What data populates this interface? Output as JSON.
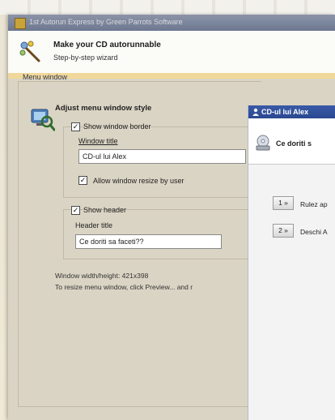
{
  "window": {
    "title": "1st Autorun Express by Green Parrots Software"
  },
  "header": {
    "title": "Make your CD autorunnable",
    "subtitle": "Step-by-step wizard"
  },
  "group": {
    "label": "Menu window",
    "section_title": "Adjust menu window style"
  },
  "border_options": {
    "show_border_label": "Show window border",
    "show_border_checked": true,
    "window_title_label": "Window title",
    "window_title_value": "CD-ul lui Alex",
    "allow_resize_label": "Allow window resize by user",
    "allow_resize_checked": true
  },
  "header_options": {
    "show_header_label": "Show header",
    "show_header_checked": true,
    "header_title_label": "Header title",
    "header_title_value": "Ce doriti sa faceti??"
  },
  "info": {
    "size_text": "Window width/height: 421x398",
    "hint_text": "To resize menu window, click Preview... and r"
  },
  "preview": {
    "title": "CD-ul lui Alex",
    "header_text": "Ce doriti s",
    "items": [
      {
        "key": "1 »",
        "label": "Rulez ap"
      },
      {
        "key": "2 »",
        "label": "Deschi A"
      }
    ]
  },
  "icons": {
    "app": "parrot-icon",
    "wizard": "wand-icon",
    "section": "monitor-magnifier-icon",
    "cd": "cd-drive-icon"
  }
}
